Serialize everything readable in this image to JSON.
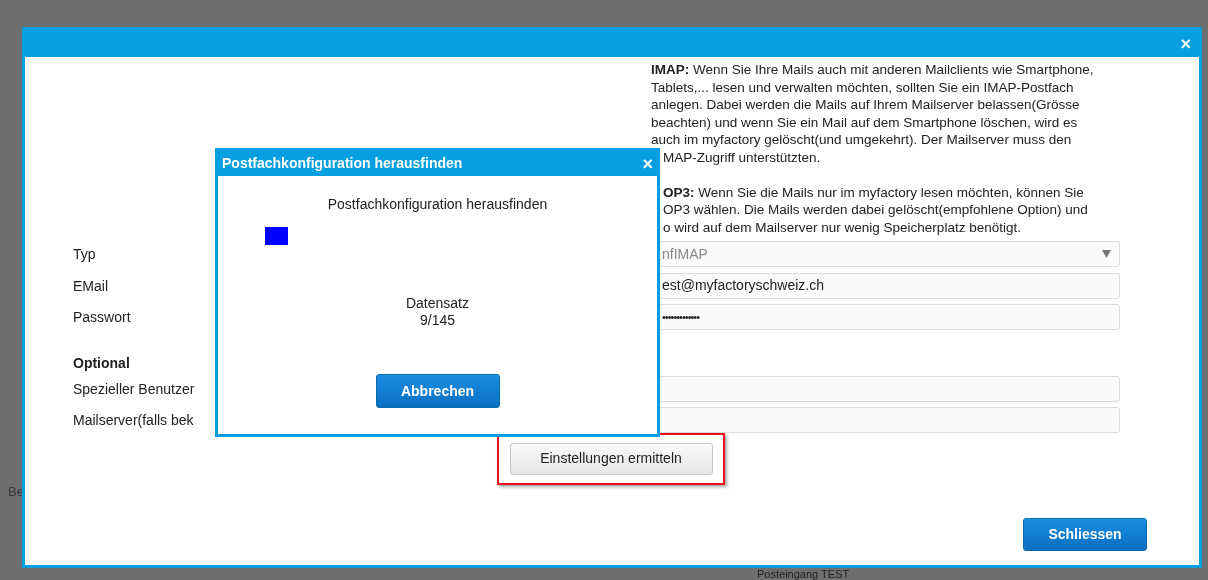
{
  "background": {
    "texts": [
      "Be",
      "Posteingang TEST"
    ]
  },
  "dialog": {
    "close": "×",
    "help_paragraphs": [
      {
        "lines": [
          "**IMAP:** Wenn Sie Ihre Mails auch mit anderen Mailclients wie Smartphone,",
          "Tablets,... lesen und verwalten möchten, sollten Sie ein IMAP-Postfach",
          "anlegen. Dabei werden die Mails auf Ihrem Mailserver belassen(Grösse",
          "beachten) und wenn Sie ein Mail auf dem Smartphone löschen, wird es",
          "auch im myfactory gelöscht(und umgekehrt). Der Mailserver muss den",
          "MAP-Zugriff unterstützten."
        ]
      },
      {
        "lines": [
          "**OP3:** Wenn Sie die Mails nur im myfactory lesen möchten, können Sie",
          "OP3 wählen. Die Mails werden dabei gelöscht(empfohlene Option) und",
          "o wird auf dem Mailserver nur wenig Speicherplatz benötigt."
        ]
      }
    ],
    "form": [
      {
        "kind": "select",
        "label": "Typ",
        "value": "nfIMAP"
      },
      {
        "kind": "text",
        "label": "EMail",
        "value": "est@myfactoryschweiz.ch"
      },
      {
        "kind": "password",
        "label": "Passwort",
        "value": "•••••••••••••"
      },
      {
        "kind": "heading",
        "label": "Optional"
      },
      {
        "kind": "text",
        "label": "Spezieller Benutzer"
      },
      {
        "kind": "text",
        "label": "Mailserver(falls bek"
      }
    ],
    "detect_button": {
      "label": "Einstellungen ermitteln",
      "highlighted": true
    },
    "close_button": "Schliessen"
  },
  "popup": {
    "title": "Postfachkonfiguration herausfinden",
    "close": "×",
    "message": "Postfachkonfiguration herausfinden",
    "record_label": "Datensatz",
    "record_count": "9/145",
    "cancel_button": "Abbrechen"
  }
}
